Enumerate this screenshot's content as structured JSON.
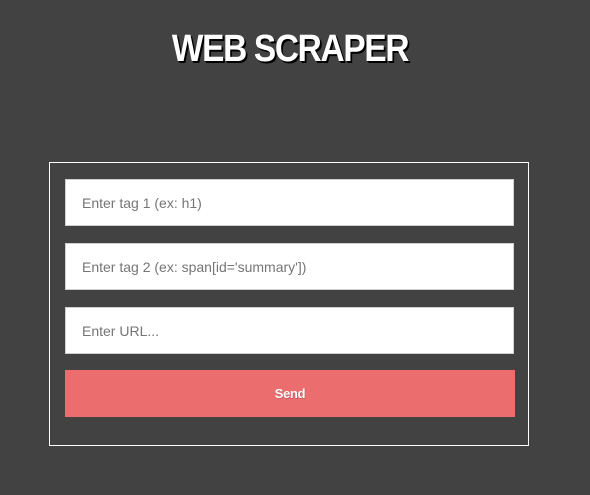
{
  "page": {
    "title": "WEB SCRAPER",
    "background_color": "#424242"
  },
  "form": {
    "tag1": {
      "value": "",
      "placeholder": "Enter tag 1 (ex: h1)"
    },
    "tag2": {
      "value": "",
      "placeholder": "Enter tag 2 (ex: span[id='summary'])"
    },
    "url": {
      "value": "",
      "placeholder": "Enter URL..."
    },
    "send_label": "Send",
    "send_color": "#ec6d6d",
    "border_color": "#ffffff"
  }
}
